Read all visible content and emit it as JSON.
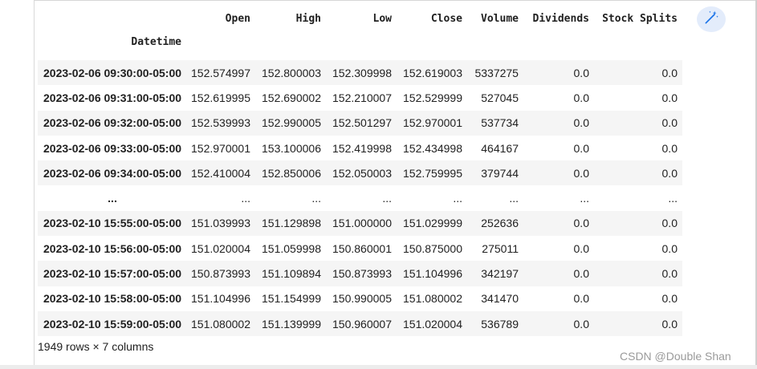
{
  "dataframe": {
    "columns": [
      "Open",
      "High",
      "Low",
      "Close",
      "Volume",
      "Dividends",
      "Stock Splits"
    ],
    "index_name": "Datetime",
    "rows": [
      {
        "index": "2023-02-06 09:30:00-05:00",
        "values": [
          "152.574997",
          "152.800003",
          "152.309998",
          "152.619003",
          "5337275",
          "0.0",
          "0.0"
        ]
      },
      {
        "index": "2023-02-06 09:31:00-05:00",
        "values": [
          "152.619995",
          "152.690002",
          "152.210007",
          "152.529999",
          "527045",
          "0.0",
          "0.0"
        ]
      },
      {
        "index": "2023-02-06 09:32:00-05:00",
        "values": [
          "152.539993",
          "152.990005",
          "152.501297",
          "152.970001",
          "537734",
          "0.0",
          "0.0"
        ]
      },
      {
        "index": "2023-02-06 09:33:00-05:00",
        "values": [
          "152.970001",
          "153.100006",
          "152.419998",
          "152.434998",
          "464167",
          "0.0",
          "0.0"
        ]
      },
      {
        "index": "2023-02-06 09:34:00-05:00",
        "values": [
          "152.410004",
          "152.850006",
          "152.050003",
          "152.759995",
          "379744",
          "0.0",
          "0.0"
        ]
      },
      {
        "index": "...",
        "values": [
          "...",
          "...",
          "...",
          "...",
          "...",
          "...",
          "..."
        ]
      },
      {
        "index": "2023-02-10 15:55:00-05:00",
        "values": [
          "151.039993",
          "151.129898",
          "151.000000",
          "151.029999",
          "252636",
          "0.0",
          "0.0"
        ]
      },
      {
        "index": "2023-02-10 15:56:00-05:00",
        "values": [
          "151.020004",
          "151.059998",
          "150.860001",
          "150.875000",
          "275011",
          "0.0",
          "0.0"
        ]
      },
      {
        "index": "2023-02-10 15:57:00-05:00",
        "values": [
          "150.873993",
          "151.109894",
          "150.873993",
          "151.104996",
          "342197",
          "0.0",
          "0.0"
        ]
      },
      {
        "index": "2023-02-10 15:58:00-05:00",
        "values": [
          "151.104996",
          "151.154999",
          "150.990005",
          "151.080002",
          "341470",
          "0.0",
          "0.0"
        ]
      },
      {
        "index": "2023-02-10 15:59:00-05:00",
        "values": [
          "151.080002",
          "151.139999",
          "150.960007",
          "151.020004",
          "536789",
          "0.0",
          "0.0"
        ]
      }
    ],
    "shape_text": "1949 rows × 7 columns"
  },
  "toolbar": {
    "magic_button_icon": "magic-wand-icon",
    "accent_color": "#1a73e8",
    "button_bg": "#e3ecfb"
  },
  "watermark": {
    "text": "CSDN @Double Shan"
  }
}
